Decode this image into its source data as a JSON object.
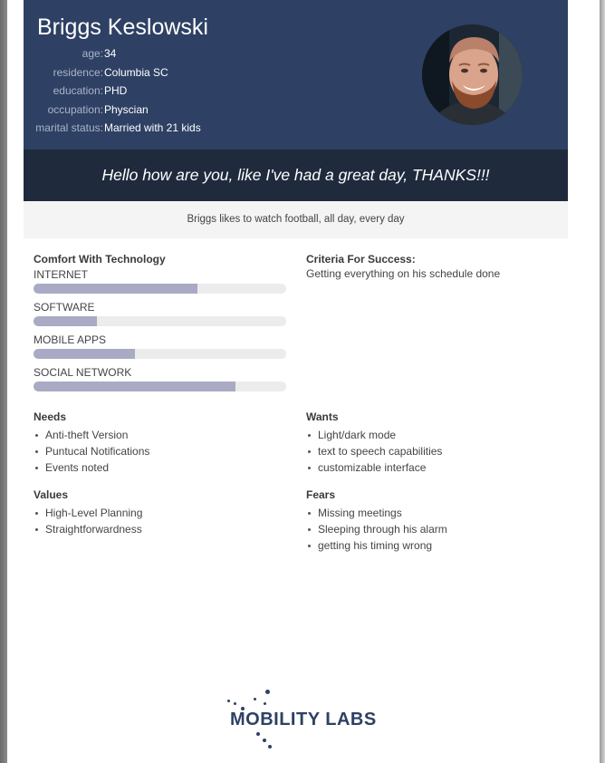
{
  "persona": {
    "name": "Briggs Keslowski",
    "facts": [
      {
        "label": "age:",
        "value": "34"
      },
      {
        "label": "residence:",
        "value": "Columbia SC"
      },
      {
        "label": "education:",
        "value": "PHD"
      },
      {
        "label": "occupation:",
        "value": "Physcian"
      },
      {
        "label": "marital status:",
        "value": "Married with 21 kids"
      }
    ],
    "quote": "Hello how are you, like I've had a great day, THANKS!!!",
    "bio": "Briggs likes to watch football, all day, every day"
  },
  "technology": {
    "title": "Comfort With Technology",
    "items": [
      {
        "label": "INTERNET",
        "level": 0.65
      },
      {
        "label": "SOFTWARE",
        "level": 0.25
      },
      {
        "label": "MOBILE APPS",
        "level": 0.4
      },
      {
        "label": "SOCIAL NETWORK",
        "level": 0.8
      }
    ]
  },
  "criteria": {
    "title": "Criteria For Success:",
    "text": "Getting everything on his schedule done"
  },
  "needs": {
    "title": "Needs",
    "items": [
      "Anti-theft Version",
      "Puntucal Notifications",
      "Events noted"
    ]
  },
  "wants": {
    "title": "Wants",
    "items": [
      "Light/dark mode",
      "text to speech capabilities",
      "customizable interface"
    ]
  },
  "values": {
    "title": "Values",
    "items": [
      "High-Level Planning",
      "Straightforwardness"
    ]
  },
  "fears": {
    "title": "Fears",
    "items": [
      "Missing meetings",
      "Sleeping through his alarm",
      "getting his timing wrong"
    ]
  },
  "logo": {
    "text": "MOBILITY LABS"
  },
  "colors": {
    "header": "#2e4164",
    "quote_band": "#1f2a3d",
    "bar_fill": "#a9aac4",
    "bar_track": "#ececec"
  }
}
